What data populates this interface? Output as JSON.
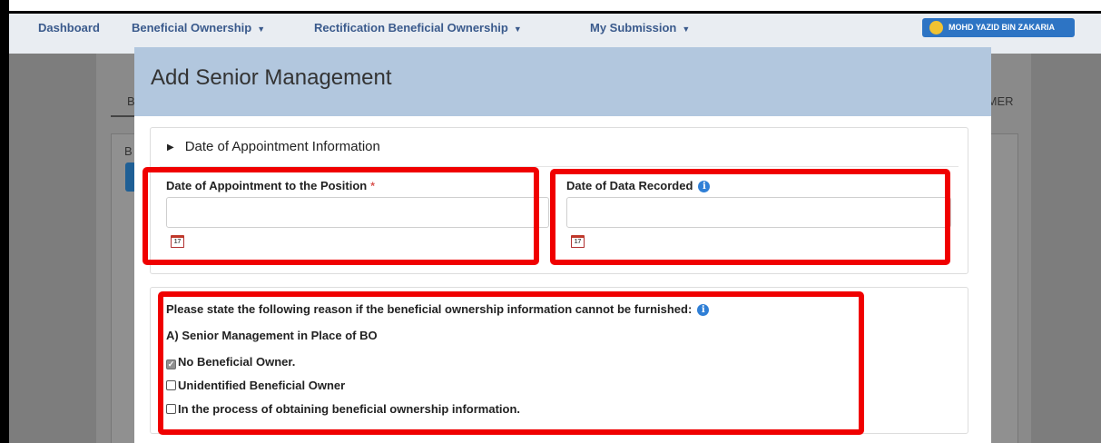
{
  "nav": {
    "items": [
      {
        "label": "Dashboard",
        "caret": false
      },
      {
        "label": "Beneficial Ownership",
        "caret": true
      },
      {
        "label": "Rectification Beneficial Ownership",
        "caret": true
      },
      {
        "label": "My Submission",
        "caret": true
      }
    ],
    "caret_glyph": "▼",
    "user_name": "MOHD YAZID BIN ZAKARIA"
  },
  "background": {
    "tab_left": "B",
    "tab_right": "IMER",
    "panel_letter": "B"
  },
  "modal": {
    "title": "Add Senior Management",
    "section": {
      "title": "Date of Appointment Information",
      "toggle_glyph": "▶"
    },
    "fields": {
      "appointment_label": "Date of Appointment to the Position",
      "appointment_required": "*",
      "appointment_value": "",
      "recorded_label": "Date of Data Recorded",
      "recorded_value": "",
      "calendar_day": "17",
      "info_glyph": "i"
    },
    "reason": {
      "prompt": "Please state the following reason if the beneficial ownership information cannot be furnished:",
      "group_label": "A) Senior Management in Place of BO",
      "options": [
        {
          "label": "No Beneficial Owner.",
          "checked": true
        },
        {
          "label": "Unidentified Beneficial Owner",
          "checked": false
        },
        {
          "label": "In the process of obtaining beneficial ownership information.",
          "checked": false
        }
      ],
      "check_glyph": "✓"
    }
  },
  "colors": {
    "nav_link": "#3a5a8c",
    "modal_header": "#b2c7de",
    "highlight": "#f00000",
    "user_pill": "#2d74c4"
  }
}
